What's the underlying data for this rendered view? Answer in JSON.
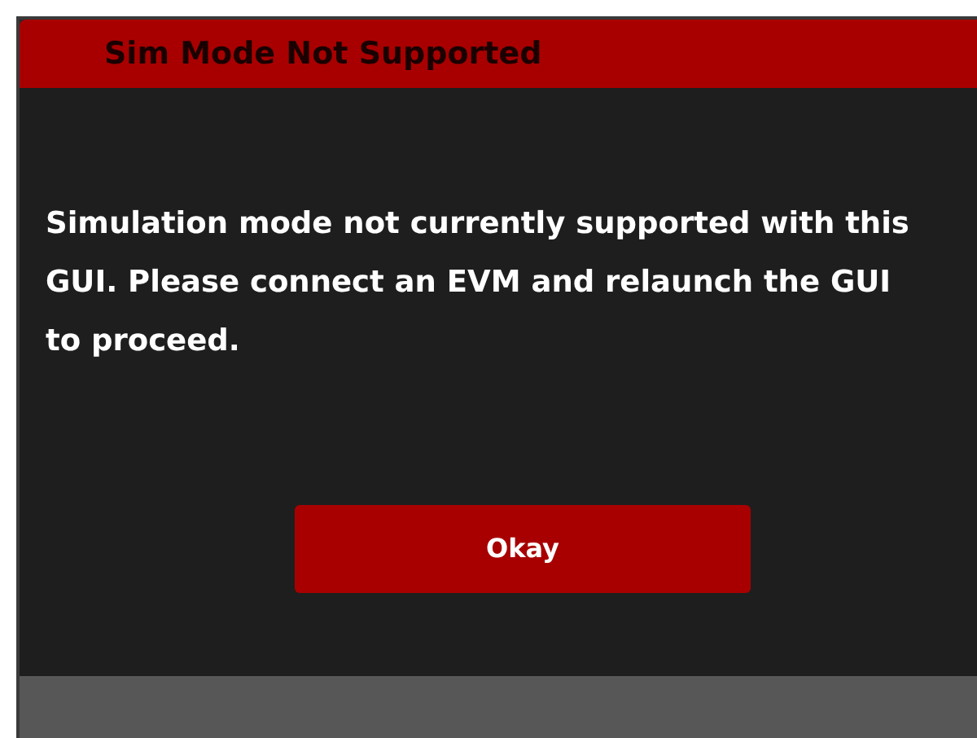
{
  "dialog": {
    "title": "Sim Mode Not Supported",
    "message": "Simulation mode not currently supported with this GUI. Please connect an EVM and relaunch the GUI to proceed.",
    "buttons": [
      "Okay"
    ]
  }
}
